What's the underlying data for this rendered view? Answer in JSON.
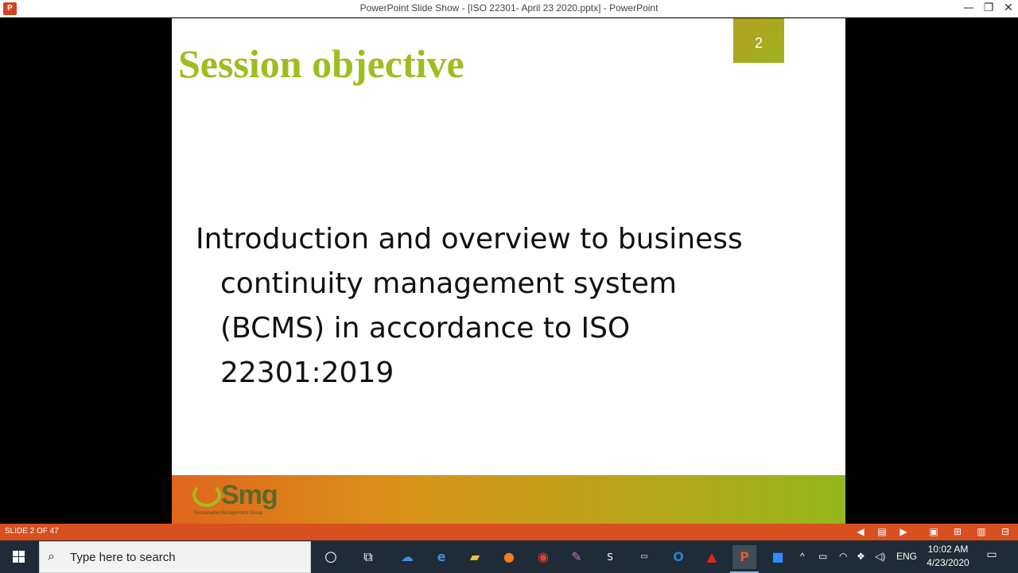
{
  "window": {
    "app_icon": "P",
    "title": "PowerPoint Slide Show - [ISO 22301- April 23 2020.pptx] - PowerPoint",
    "minimize_label": "—",
    "maximize_label": "❐",
    "close_label": "✕"
  },
  "slide": {
    "title": "Session objective",
    "number": "2",
    "body_lines": [
      "Introduction and overview to business",
      "continuity management system",
      "(BCMS) in accordance to ISO",
      "22301:2019"
    ],
    "logo_text": "Smg",
    "logo_tagline": "Sustainable Management Group",
    "colors": {
      "title": "#9cbe1f",
      "number_bg": "#b3a021"
    }
  },
  "statusbar": {
    "counter": "SLIDE 2 OF 47",
    "buttons": [
      "previous-icon",
      "slide-notes-icon",
      "next-icon",
      "normal-view-icon",
      "slide-sorter-icon",
      "reading-view-icon",
      "slideshow-icon"
    ]
  },
  "taskbar": {
    "search_placeholder": "Type here to search",
    "pinned": [
      "cortana-icon",
      "task-view-icon",
      "onedrive-icon",
      "edge-icon",
      "file-explorer-icon",
      "firefox-icon",
      "chrome-icon",
      "notes-icon",
      "s-app-icon",
      "smg-app-icon",
      "outlook-icon",
      "acrobat-icon",
      "powerpoint-icon",
      "zoom-icon"
    ],
    "tray": {
      "language": "ENG",
      "time": "10:02 AM",
      "date": "4/23/2020"
    }
  }
}
